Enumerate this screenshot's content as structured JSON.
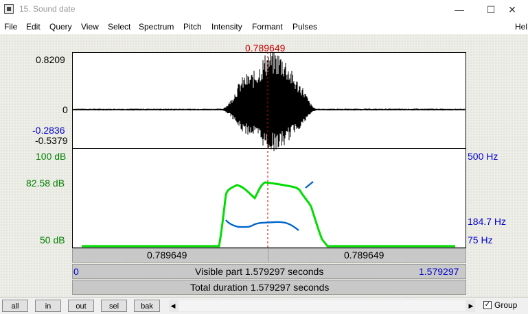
{
  "window": {
    "title": "15. Sound date",
    "minimize": "—",
    "maximize": "☐",
    "close": "✕"
  },
  "menu": [
    "File",
    "Edit",
    "Query",
    "View",
    "Select",
    "Spectrum",
    "Pitch",
    "Intensity",
    "Formant",
    "Pulses",
    "Hel"
  ],
  "cursor": {
    "time_label": "0.789649"
  },
  "waveform": {
    "max_label": "0.8209",
    "zero_label": "0",
    "min_blue_label": "-0.2836",
    "min_label": "-0.5379"
  },
  "intensity": {
    "top_label": "100 dB",
    "mid_label": "82.58 dB",
    "bottom_label": "50 dB"
  },
  "pitch": {
    "top_label": "500 Hz",
    "mid_label": "184.7 Hz",
    "bottom_label": "75 Hz"
  },
  "time_bar": {
    "left": "0.789649",
    "right": "0.789649"
  },
  "visible_bar": {
    "start": "0",
    "label": "Visible part 1.579297 seconds",
    "end": "1.579297"
  },
  "total_bar": {
    "label": "Total duration 1.579297 seconds"
  },
  "buttons": {
    "all": "all",
    "in": "in",
    "out": "out",
    "sel": "sel",
    "bak": "bak"
  },
  "scrollbar": {
    "left_arrow": "◀",
    "right_arrow": "▶"
  },
  "group": {
    "label": "Group",
    "checked": "✓"
  },
  "colors": {
    "cursor": "#cc0000",
    "intensity": "#00dd00",
    "pitch": "#0066cc",
    "label_green": "#008000",
    "label_blue": "#0000cc"
  }
}
